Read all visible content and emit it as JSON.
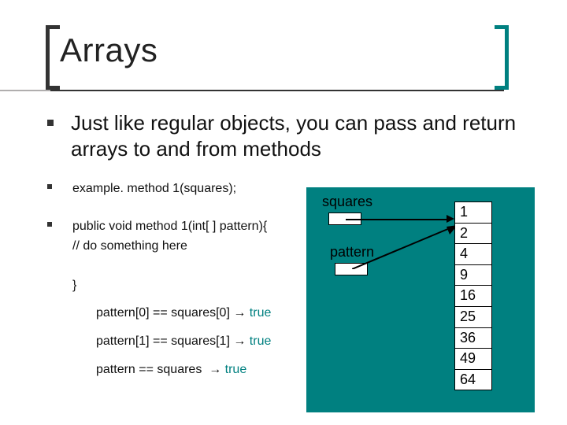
{
  "title": "Arrays",
  "main": "Just like regular objects, you can pass and return arrays to and from methods",
  "code": {
    "call": "example. method 1(squares);",
    "sig": "public void method 1(int[ ] pattern){",
    "comment": "// do something here",
    "close": "}"
  },
  "asserts": {
    "a1_lhs": "pattern[0] == squares[0]",
    "a2_lhs": "pattern[1] == squares[1]",
    "a3_lhs": "pattern == squares",
    "arrow": "→",
    "rhs": "true"
  },
  "diagram": {
    "label_squares": "squares",
    "label_pattern": "pattern",
    "cells": [
      "1",
      "2",
      "4",
      "9",
      "16",
      "25",
      "36",
      "49",
      "64"
    ]
  }
}
